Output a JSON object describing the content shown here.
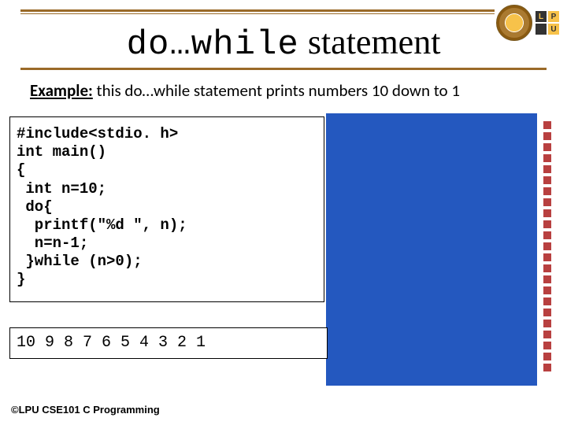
{
  "title_mono": "do…while",
  "title_rest": " statement",
  "subtitle_ex": "Example:",
  "subtitle_rest": " this do…while statement prints numbers 10 down to 1",
  "code": "#include<stdio. h>\nint main()\n{\n int n=10;\n do{\n  printf(\"%d \", n);\n  n=n-1;\n }while (n>0);\n}",
  "output": "10 9 8 7 6 5 4 3 2 1",
  "footer": "©LPU CSE101 C Programming",
  "lpu": {
    "l": "L",
    "p": "P",
    "u": "U"
  }
}
